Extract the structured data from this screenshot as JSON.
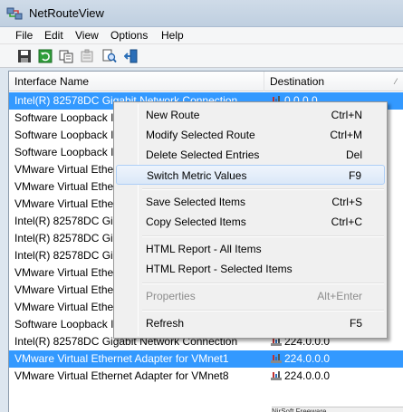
{
  "window": {
    "title": "NetRouteView",
    "icon": "network-route-app-icon"
  },
  "menubar": {
    "items": [
      {
        "label": "File"
      },
      {
        "label": "Edit"
      },
      {
        "label": "View"
      },
      {
        "label": "Options"
      },
      {
        "label": "Help"
      }
    ]
  },
  "toolbar": {
    "buttons": [
      {
        "icon": "save-icon"
      },
      {
        "icon": "refresh-icon"
      },
      {
        "icon": "copy-icon"
      },
      {
        "icon": "properties-icon"
      },
      {
        "icon": "find-icon"
      },
      {
        "icon": "exit-icon"
      }
    ]
  },
  "table": {
    "columns": [
      {
        "label": "Interface Name"
      },
      {
        "label": "Destination"
      }
    ],
    "sort_indicator": "⁄",
    "rows": [
      {
        "name": "Intel(R) 82578DC Gigabit Network Connection",
        "destination": "0.0.0.0",
        "selected": true
      },
      {
        "name": "Software Loopback Interface 1",
        "destination": "",
        "selected": false
      },
      {
        "name": "Software Loopback Interface 1",
        "destination": "",
        "selected": false
      },
      {
        "name": "Software Loopback Interface 1",
        "destination": "",
        "selected": false
      },
      {
        "name": "VMware Virtual Ethernet Adapter for VMnet8",
        "destination": "",
        "selected": false
      },
      {
        "name": "VMware Virtual Ethernet Adapter for VMnet8",
        "destination": "",
        "selected": false
      },
      {
        "name": "VMware Virtual Ethernet Adapter for VMnet8",
        "destination": "",
        "selected": false
      },
      {
        "name": "Intel(R) 82578DC Gigabit Network Connection",
        "destination": "",
        "selected": false
      },
      {
        "name": "Intel(R) 82578DC Gigabit Network Connection",
        "destination": "",
        "selected": false
      },
      {
        "name": "Intel(R) 82578DC Gigabit Network Connection",
        "destination": "",
        "selected": false
      },
      {
        "name": "VMware Virtual Ethernet Adapter for VMnet1",
        "destination": "",
        "selected": false
      },
      {
        "name": "VMware Virtual Ethernet Adapter for VMnet1",
        "destination": "",
        "selected": false
      },
      {
        "name": "VMware Virtual Ethernet Adapter for VMnet1",
        "destination": "",
        "selected": false
      },
      {
        "name": "Software Loopback Interface 1",
        "destination": "",
        "selected": false
      },
      {
        "name": "Intel(R) 82578DC Gigabit Network Connection",
        "destination": "224.0.0.0",
        "selected": false
      },
      {
        "name": "VMware Virtual Ethernet Adapter for VMnet1",
        "destination": "224.0.0.0",
        "selected": true
      },
      {
        "name": "VMware Virtual Ethernet Adapter for VMnet8",
        "destination": "224.0.0.0",
        "selected": false
      }
    ]
  },
  "status_strip": {
    "text": "NirSoft Freeware"
  },
  "context_menu": {
    "items": [
      {
        "label": "New Route",
        "shortcut": "Ctrl+N"
      },
      {
        "label": "Modify Selected Route",
        "shortcut": "Ctrl+M"
      },
      {
        "label": "Delete Selected Entries",
        "shortcut": "Del"
      },
      {
        "label": "Switch Metric Values",
        "shortcut": "F9"
      },
      {
        "label": "Save Selected Items",
        "shortcut": "Ctrl+S"
      },
      {
        "label": "Copy Selected Items",
        "shortcut": "Ctrl+C"
      },
      {
        "label": "HTML Report - All Items",
        "shortcut": ""
      },
      {
        "label": "HTML Report - Selected Items",
        "shortcut": ""
      },
      {
        "label": "Properties",
        "shortcut": "Alt+Enter"
      },
      {
        "label": "Refresh",
        "shortcut": "F5"
      }
    ]
  },
  "colors": {
    "selection": "#3399ff",
    "menu_hover_border": "#aecff7",
    "window_frame": "#dde6ef"
  }
}
